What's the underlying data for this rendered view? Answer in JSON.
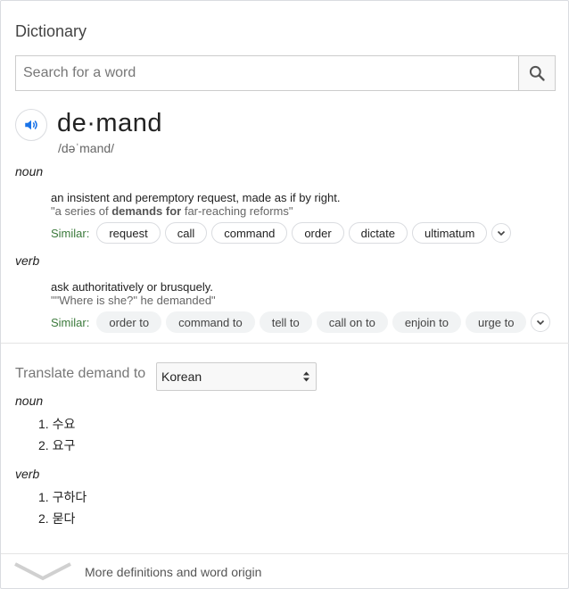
{
  "header": {
    "title": "Dictionary"
  },
  "search": {
    "placeholder": "Search for a word",
    "value": ""
  },
  "entry": {
    "word": "de·mand",
    "phonetic": "/dəˈmand/",
    "senses": [
      {
        "pos": "noun",
        "definition": "an insistent and peremptory request, made as if by right.",
        "example_pre": "\"a series of ",
        "example_bold": "demands for",
        "example_post": " far-reaching reforms\"",
        "similar_label": "Similar:",
        "similar": [
          "request",
          "call",
          "command",
          "order",
          "dictate",
          "ultimatum"
        ]
      },
      {
        "pos": "verb",
        "definition": "ask authoritatively or brusquely.",
        "example": "\"\"Where is she?\" he demanded\"",
        "similar_label": "Similar:",
        "similar": [
          "order to",
          "command to",
          "tell to",
          "call on to",
          "enjoin to",
          "urge to"
        ]
      }
    ]
  },
  "translate": {
    "label": "Translate demand to",
    "language": "Korean",
    "groups": [
      {
        "pos": "noun",
        "items": [
          "1. 수요",
          "2. 요구"
        ]
      },
      {
        "pos": "verb",
        "items": [
          "1. 구하다",
          "2. 묻다"
        ]
      }
    ]
  },
  "footer": {
    "more_label": "More definitions and word origin"
  },
  "colors": {
    "accent": "#1a73e8",
    "similar_green": "#3c7a3c",
    "chip_grey": "#f1f3f4"
  },
  "icons": [
    "search-icon",
    "speaker-icon",
    "chevron-down-icon",
    "select-arrows-icon"
  ]
}
